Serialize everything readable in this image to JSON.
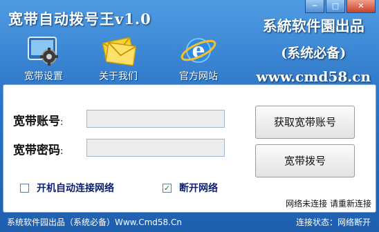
{
  "window": {
    "title": "宽带自动拨号王v1.0",
    "controls": {
      "minimize": "─",
      "maximize": "□",
      "close": "✕"
    }
  },
  "toolbar": {
    "items": [
      {
        "label": "宽带设置",
        "icon": "settings-gear-icon"
      },
      {
        "label": "关于我们",
        "icon": "envelope-icon"
      },
      {
        "label": "官方网站",
        "icon": "ie-browser-icon"
      }
    ]
  },
  "brand": {
    "line1": "系統软件園出品",
    "line2": "(系统必备)",
    "line3": "www.cmd58.cn"
  },
  "form": {
    "account_label": "宽带账号",
    "password_label": "宽带密码",
    "account_value": "",
    "password_value": "",
    "get_account_button": "获取宽带账号",
    "dial_button": "宽带拨号",
    "auto_connect_label": "开机自动连接网络",
    "auto_connect_checked": false,
    "disconnect_label": "断开网络",
    "disconnect_checked": true,
    "network_message": "网络未连接 请重新连接"
  },
  "statusbar": {
    "left": "系统软件园出品（系统必备）Www.Cmd58.Cn",
    "right": "连接状态：网络断开"
  },
  "colors": {
    "title_bar_top": "#4f9be2",
    "title_bar_bottom": "#1e5fae",
    "panel_background": "#ffffff",
    "input_background": "#ececec",
    "checkbox_label": "#0d1f6e"
  }
}
